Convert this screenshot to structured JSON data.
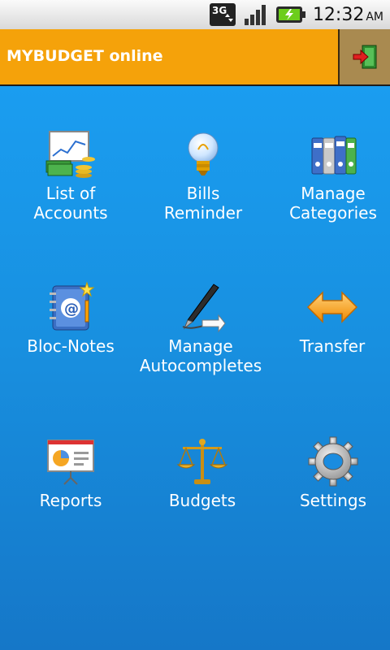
{
  "status_bar": {
    "network": "3G",
    "time": "12:32",
    "ampm": "AM"
  },
  "app_bar": {
    "title": "MYBUDGET online"
  },
  "menu": [
    {
      "label": "List of\nAccounts",
      "icon": "accounts-icon"
    },
    {
      "label": "Bills\nReminder",
      "icon": "lightbulb-icon"
    },
    {
      "label": "Manage\nCategories",
      "icon": "binders-icon"
    },
    {
      "label": "Bloc-Notes",
      "icon": "address-book-icon"
    },
    {
      "label": "Manage\nAutocompletes",
      "icon": "pen-icon"
    },
    {
      "label": "Transfer",
      "icon": "double-arrow-icon"
    },
    {
      "label": "Reports",
      "icon": "presentation-icon"
    },
    {
      "label": "Budgets",
      "icon": "scales-icon"
    },
    {
      "label": "Settings",
      "icon": "gear-icon"
    }
  ]
}
